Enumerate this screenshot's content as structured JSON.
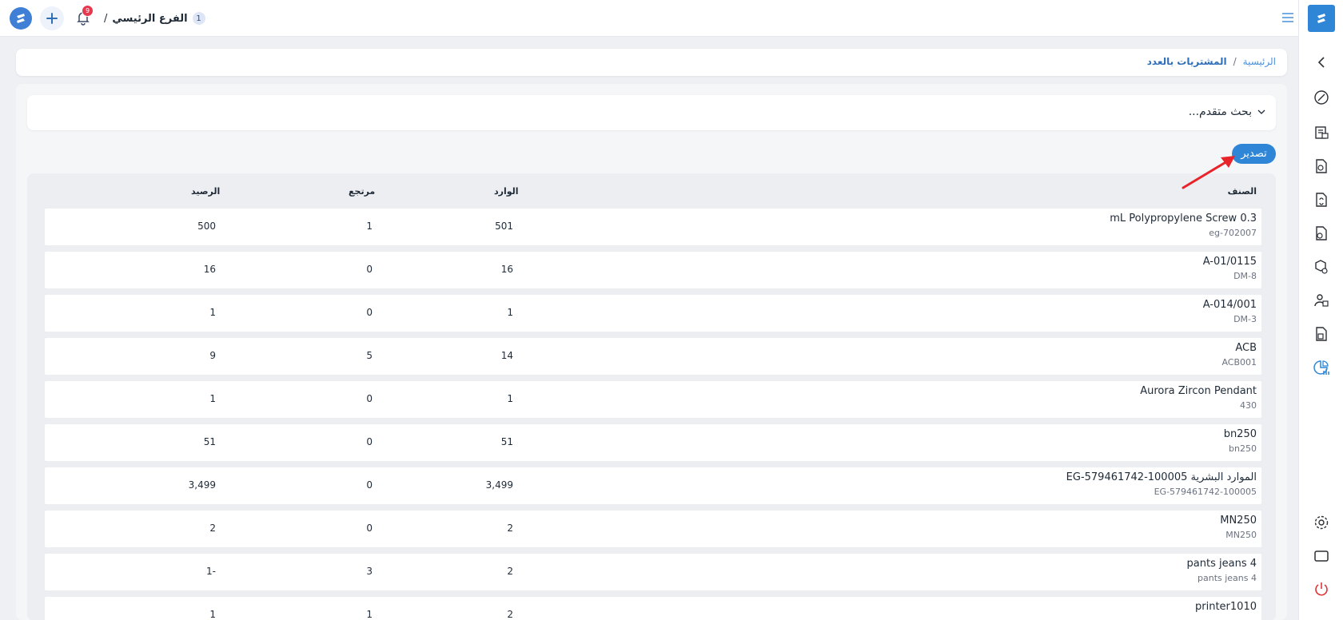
{
  "topbar": {
    "branch_number": "1",
    "branch_name": "الفرع الرئيسي",
    "branch_sep": "/",
    "notification_badge": "9",
    "logo_icon": "swirl-logo-icon",
    "add_icon": "plus-icon",
    "bell_icon": "bell-icon",
    "menu_icon": "hamburger-menu-icon"
  },
  "breadcrumb": {
    "home": "الرئيسية",
    "sep": "/",
    "current": "المشتريات بالعدد"
  },
  "advanced_search": {
    "label": "بحث متقدم...",
    "chevron_icon": "chevron-down-icon"
  },
  "export_button": "تصدير",
  "table": {
    "headers": {
      "item": "الصنف",
      "incoming": "الوارد",
      "returned": "مرتجع",
      "balance": "الرصيد"
    },
    "rows": [
      {
        "name": "mL Polypropylene Screw 0.3",
        "code": "eg-702007",
        "incoming": "501",
        "returned": "1",
        "balance": "500"
      },
      {
        "name": "A-01/0115",
        "code": "DM-8",
        "incoming": "16",
        "returned": "0",
        "balance": "16"
      },
      {
        "name": "A-014/001",
        "code": "DM-3",
        "incoming": "1",
        "returned": "0",
        "balance": "1"
      },
      {
        "name": "ACB",
        "code": "ACB001",
        "incoming": "14",
        "returned": "5",
        "balance": "9"
      },
      {
        "name": "Aurora Zircon Pendant",
        "code": "430",
        "incoming": "1",
        "returned": "0",
        "balance": "1"
      },
      {
        "name": "bn250",
        "code": "bn250",
        "incoming": "51",
        "returned": "0",
        "balance": "51"
      },
      {
        "name": "EG-579461742-100005 الموارد البشرية",
        "code": "EG-579461742-100005",
        "incoming": "3,499",
        "returned": "0",
        "balance": "3,499"
      },
      {
        "name": "MN250",
        "code": "MN250",
        "incoming": "2",
        "returned": "0",
        "balance": "2"
      },
      {
        "name": "pants jeans 4",
        "code": "pants jeans 4",
        "incoming": "2",
        "returned": "3",
        "balance": "1-"
      },
      {
        "name": "printer1010",
        "code": "",
        "incoming": "2",
        "returned": "1",
        "balance": "1"
      }
    ]
  },
  "sidebar": {
    "brand_icon": "brand-logo-icon",
    "items": [
      "collapse-chevron-icon",
      "dashboard-gauge-icon",
      "inventory-icon",
      "search-document-icon",
      "invoice-icon",
      "purchase-document-icon",
      "delivery-truck-icon",
      "users-icon",
      "box-document-icon",
      "reports-chart-icon",
      "settings-gear-icon",
      "display-screen-icon",
      "power-icon"
    ]
  },
  "colors": {
    "accent": "#2f86d6",
    "badge": "#e53950",
    "arrow": "#e8242a",
    "active_icon": "#2f86d6"
  }
}
